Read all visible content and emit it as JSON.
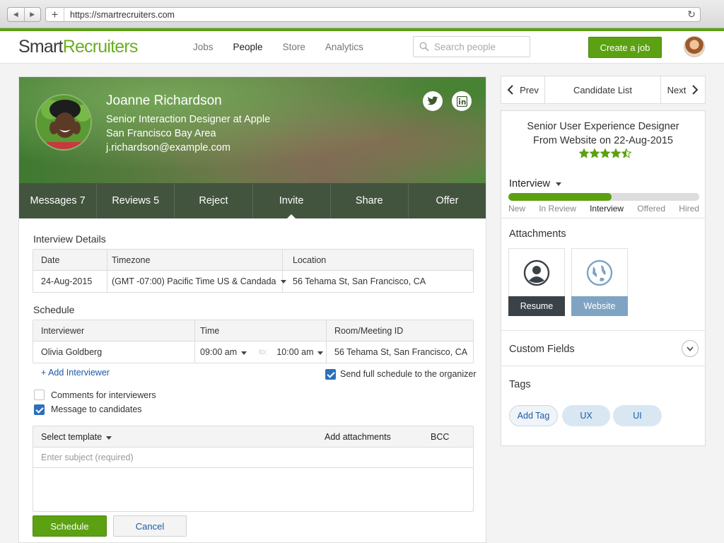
{
  "browser": {
    "url": "https://smartrecruiters.com"
  },
  "header": {
    "logo_part1": "Smart",
    "logo_part2": "Recruiters",
    "nav": [
      "Jobs",
      "People",
      "Store",
      "Analytics"
    ],
    "active_nav": "People",
    "search_placeholder": "Search people",
    "create_job_label": "Create a job"
  },
  "profile": {
    "name": "Joanne Richardson",
    "title": "Senior Interaction Designer at Apple",
    "location": "San Francisco Bay Area",
    "email": "j.richardson@example.com",
    "actions": [
      "Messages 7",
      "Reviews 5",
      "Reject",
      "Invite",
      "Share",
      "Offer"
    ],
    "active_action": "Invite"
  },
  "interview_details": {
    "title": "Interview Details",
    "headers": [
      "Date",
      "Timezone",
      "Location"
    ],
    "date": "24-Aug-2015",
    "timezone": "(GMT -07:00) Pacific Time US & Candada",
    "location": "56 Tehama St, San Francisco, CA"
  },
  "schedule": {
    "title": "Schedule",
    "headers": [
      "Interviewer",
      "Time",
      "Room/Meeting ID"
    ],
    "interviewer": "Olivia Goldberg",
    "time_from": "09:00 am",
    "time_to_label": "to:",
    "time_to": "10:00 am",
    "room": "56 Tehama St, San Francisco, CA",
    "add_interviewer": "+ Add Interviewer",
    "send_schedule_label": "Send full schedule to the organizer",
    "send_schedule_checked": true
  },
  "options": {
    "comments_label": "Comments for interviewers",
    "comments_checked": false,
    "message_label": "Message to candidates",
    "message_checked": true
  },
  "message": {
    "select_template": "Select template",
    "add_attachments": "Add attachments",
    "bcc": "BCC",
    "subject_placeholder": "Enter subject (required)"
  },
  "buttons": {
    "schedule": "Schedule",
    "cancel": "Cancel"
  },
  "pager": {
    "prev": "Prev",
    "list": "Candidate List",
    "next": "Next"
  },
  "job": {
    "title": "Senior User Experience Designer",
    "source": "From Website on 22-Aug-2015",
    "rating": 4.5,
    "rating_max": 5
  },
  "pipeline": {
    "stage": "Interview",
    "steps": [
      "New",
      "In Review",
      "Interview",
      "Offered",
      "Hired"
    ],
    "current_step": "Interview",
    "progress": 0.54
  },
  "attachments": {
    "title": "Attachments",
    "items": [
      "Resume",
      "Website"
    ]
  },
  "custom_fields": {
    "title": "Custom Fields"
  },
  "tags": {
    "title": "Tags",
    "add_label": "Add Tag",
    "items": [
      "UX",
      "UI"
    ]
  },
  "colors": {
    "brand_green": "#5ba112",
    "link_blue": "#1a5aa6",
    "tag_bg": "#d9e7f3",
    "resume_bg": "#3a4248",
    "website_bg": "#7fa4c3"
  }
}
